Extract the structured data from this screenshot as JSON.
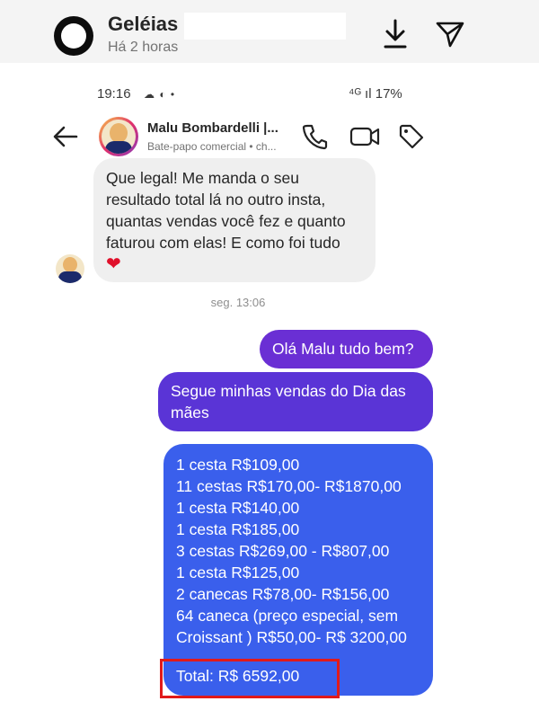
{
  "story_header": {
    "title": "Geléias a",
    "time": "Há 2 horas"
  },
  "status_bar": {
    "time": "19:16",
    "icons": "☁ ◐ •",
    "right": "⁴ᴳ ıl 17%"
  },
  "chat_header": {
    "name": "Malu Bombardelli |...",
    "subtitle": "Bate-papo comercial • ch..."
  },
  "incoming_message": {
    "text": "Que legal! Me manda o seu resultado total lá no outro insta, quantas vendas você fez e quanto faturou com elas! E como foi tudo",
    "emoji": "❤"
  },
  "timestamp": "seg. 13:06",
  "outgoing_messages": {
    "greeting": "Olá Malu tudo bem?",
    "intro": "Segue minhas vendas do Dia das mães",
    "sales_lines": [
      "1 cesta R$109,00",
      "11 cestas R$170,00- R$1870,00",
      "1 cesta R$140,00",
      "1 cesta R$185,00",
      "3 cestas R$269,00 - R$807,00",
      "1 cesta R$125,00",
      "2 canecas R$78,00- R$156,00",
      "64 caneca (preço especial, sem",
      "Croissant ) R$50,00- R$ 3200,00"
    ],
    "total": "Total: R$ 6592,00"
  },
  "colors": {
    "bubble_purple": "#6a2fd4",
    "bubble_violet": "#5a34d6",
    "bubble_blue": "#3a5fec",
    "highlight_red": "#e11a1a"
  }
}
